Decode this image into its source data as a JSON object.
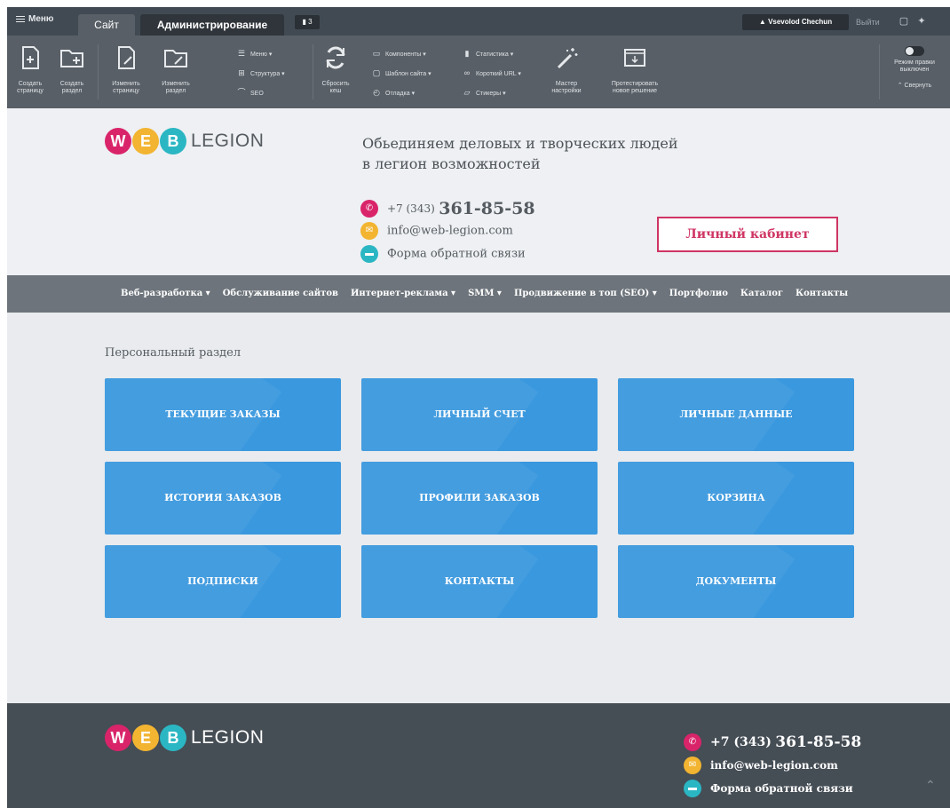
{
  "admin": {
    "menu_label": "Меню",
    "tab_site": "Сайт",
    "tab_admin": "Администрирование",
    "notifications": "3",
    "user_name": "Vsevolod Chechun",
    "logout": "Выйти",
    "tools": {
      "create_page": "Создать\nстраницу",
      "create_section": "Создать\nраздел",
      "edit_page": "Изменить\nстраницу",
      "edit_section": "Изменить\nраздел",
      "menu": "Меню",
      "structure": "Структура",
      "seo": "SEO",
      "reset_cache": "Сбросить\nкеш",
      "components": "Компоненты",
      "site_template": "Шаблон сайта",
      "debug": "Отладка",
      "statistics": "Статистика",
      "short_url": "Короткий URL",
      "stickers": "Стикеры",
      "wizard": "Мастер\nнастройки",
      "test_solution": "Протестировать\nновое решение",
      "edit_mode": "Режим правки\nвыключен",
      "collapse": "Свернуть"
    }
  },
  "header": {
    "logo_letters": [
      "W",
      "E",
      "B"
    ],
    "logo_text": "LEGION",
    "slogan_line1": "Обьединяем деловых и творческих людей",
    "slogan_line2": "в легион возможностей",
    "phone_prefix": "+7 (343)",
    "phone_number": "361-85-58",
    "email": "info@web-legion.com",
    "feedback": "Форма обратной связи",
    "cabinet_button": "Личный кабинет"
  },
  "nav": [
    "Веб-разработка ▾",
    "Обслуживание сайтов",
    "Интернет-реклама ▾",
    "SMM ▾",
    "Продвижение в топ (SEO) ▾",
    "Портфолио",
    "Каталог",
    "Контакты"
  ],
  "content": {
    "section_title": "Персональный раздел",
    "tiles": [
      "ТЕКУЩИЕ ЗАКАЗЫ",
      "ЛИЧНЫЙ СЧЕТ",
      "ЛИЧНЫЕ ДАННЫЕ",
      "ИСТОРИЯ ЗАКАЗОВ",
      "ПРОФИЛИ ЗАКАЗОВ",
      "КОРЗИНА",
      "ПОДПИСКИ",
      "КОНТАКТЫ",
      "ДОКУМЕНТЫ"
    ]
  },
  "footer": {
    "phone_prefix": "+7 (343)",
    "phone_number": "361-85-58",
    "email": "info@web-legion.com",
    "feedback": "Форма обратной связи"
  },
  "colors": {
    "logo_w": "#d9246a",
    "logo_e": "#f2b431",
    "logo_b": "#2bb6c3",
    "tile": "#3a98de",
    "accent": "#cf3564"
  },
  "icons": {
    "phone": "phone-icon",
    "email": "email-icon",
    "feedback": "chat-icon"
  }
}
